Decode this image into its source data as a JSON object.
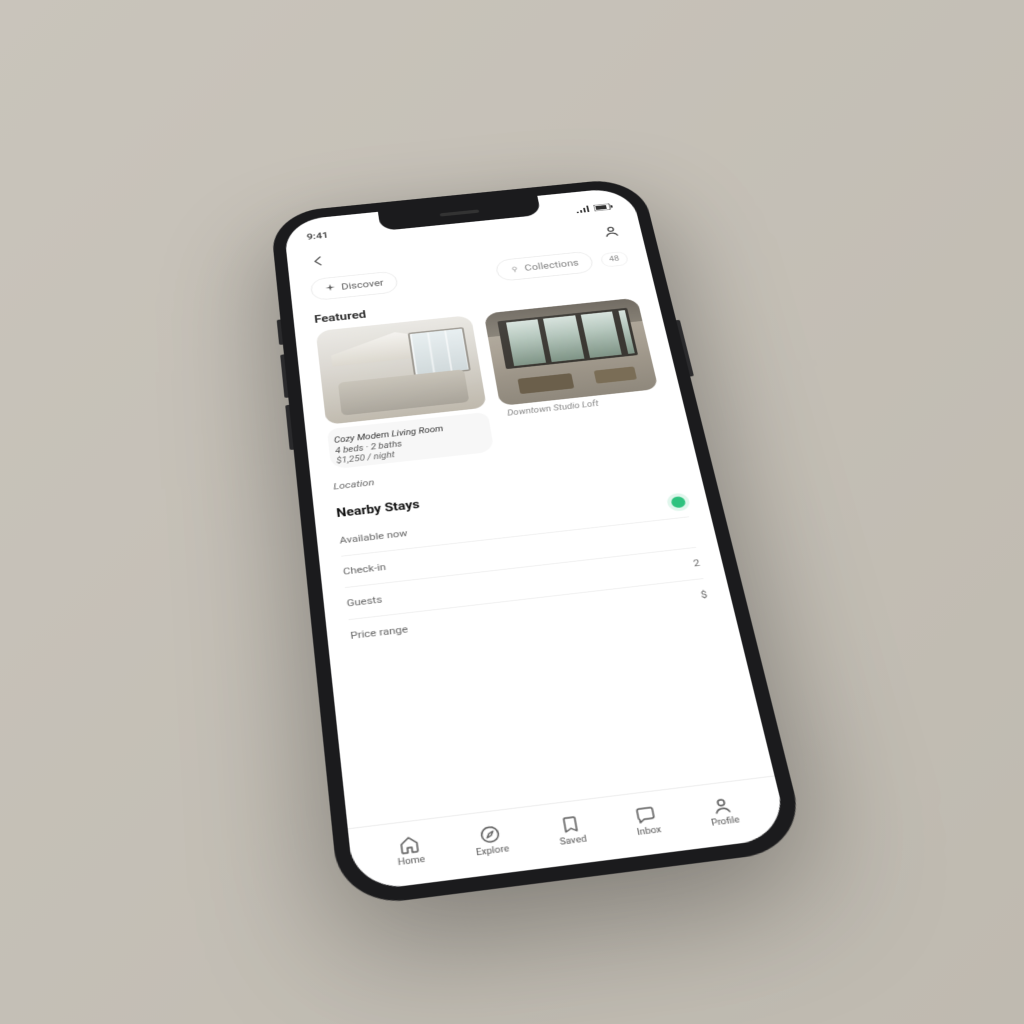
{
  "status": {
    "time": "9:41"
  },
  "filter": {
    "primary_label": "Discover",
    "secondary_label": "Collections",
    "count_label": "48"
  },
  "section1_title": "Featured",
  "cards": [
    {
      "title": "Cozy Modern Living Room",
      "sub1": "4 beds · 2 baths",
      "sub2": "$1,250 / night"
    },
    {
      "title": "",
      "sub_below": "Downtown Studio Loft"
    }
  ],
  "meta1": {
    "label": "Location",
    "value": ""
  },
  "section2_title": "Nearby Stays",
  "list": [
    {
      "label": "Available now",
      "value": "",
      "dot": true
    },
    {
      "label": "Check-in",
      "value": ""
    },
    {
      "label": "Guests",
      "value": "2"
    },
    {
      "label": "Price range",
      "value": "$"
    }
  ],
  "tabs": [
    "Home",
    "Explore",
    "Saved",
    "Inbox",
    "Profile"
  ],
  "colors": {
    "accent": "#2ec27e"
  }
}
